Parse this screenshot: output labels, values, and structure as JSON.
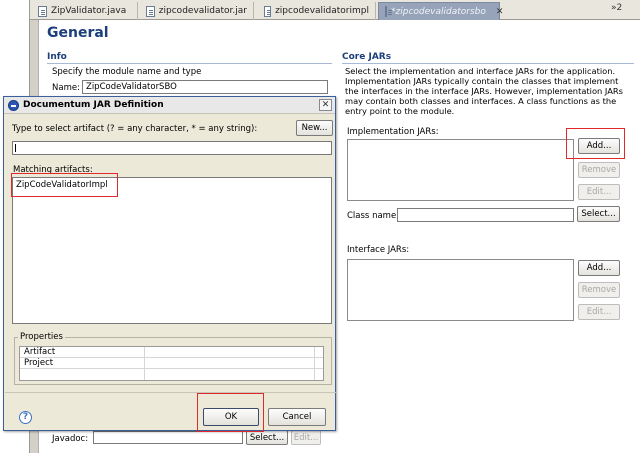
{
  "tabs": [
    {
      "label": "ZipValidator.java"
    },
    {
      "label": "zipcodevalidator.jar"
    },
    {
      "label": "zipcodevalidatorimpl"
    },
    {
      "label": "*zipcodevalidatorsbo"
    }
  ],
  "tab_overflow": "»2",
  "editor": {
    "page_title": "General",
    "info": {
      "heading": "Info",
      "description": "Specify the module name and type",
      "name_label": "Name:",
      "name_value": "ZipCodeValidatorSBO"
    },
    "core_jars": {
      "heading": "Core JARs",
      "description": "Select the implementation and interface JARs for the application. Implementation JARs typically contain the classes that implement the interfaces in the interface JARs. However, implementation JARs may contain both classes and interfaces. A class functions as the entry point to the module.",
      "implementation_label": "Implementation JARs:",
      "class_name_label": "Class name:",
      "interface_label": "Interface JARs:",
      "add_label": "Add...",
      "remove_label": "Remove",
      "edit_label": "Edit...",
      "select_label": "Select..."
    },
    "javadoc": {
      "label": "Javadoc:",
      "select_label": "Select...",
      "edit_label": "Edit..."
    }
  },
  "dialog": {
    "title": "Documentum JAR Definition",
    "close_glyph": "✕",
    "filter_label": "Type to select artifact (? = any character, * = any string):",
    "filter_value": "",
    "new_label": "New...",
    "matching_label": "Matching artifacts:",
    "artifacts": [
      "ZipCodeValidatorImpl"
    ],
    "properties_label": "Properties",
    "properties": [
      {
        "name": "Artifact",
        "value": ""
      },
      {
        "name": "Project",
        "value": ""
      }
    ],
    "ok_label": "OK",
    "cancel_label": "Cancel",
    "help_glyph": "?"
  },
  "colors": {
    "highlight": "#e0292b",
    "section_heading": "#1c3f7b",
    "active_tab": "#96a3b8"
  }
}
